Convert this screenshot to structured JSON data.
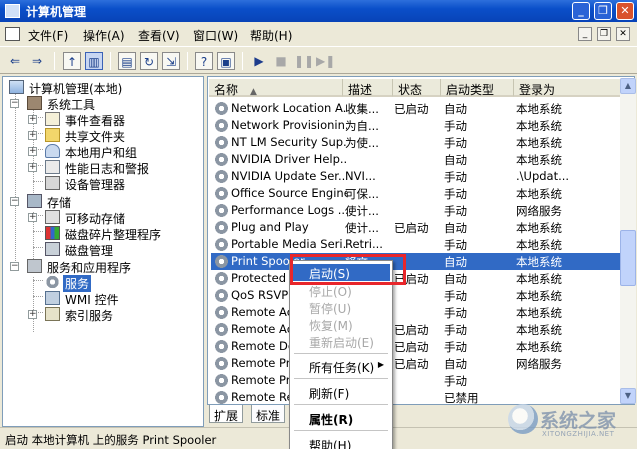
{
  "window": {
    "title": "计算机管理",
    "controls": {
      "minimize": "_",
      "restore": "❐",
      "close": "✕"
    }
  },
  "menubar": {
    "items": [
      "文件(F)",
      "操作(A)",
      "查看(V)",
      "窗口(W)",
      "帮助(H)"
    ],
    "mdi_controls": {
      "minimize": "_",
      "restore": "❐",
      "close": "✕"
    }
  },
  "toolbar": {
    "icons": [
      "back-icon",
      "forward-icon",
      "up-folder-icon",
      "show-tree-icon",
      "properties-icon",
      "refresh-icon",
      "export-icon",
      "help-icon",
      "show-panel-icon",
      "start-icon",
      "stop-icon",
      "pause-icon",
      "restart-icon"
    ]
  },
  "tree": {
    "root": "计算机管理(本地)",
    "nodes": [
      {
        "label": "系统工具",
        "icon": "tools-icon",
        "expander": "−"
      },
      {
        "label": "事件查看器",
        "icon": "event-viewer-icon",
        "expander": "+"
      },
      {
        "label": "共享文件夹",
        "icon": "folder-icon",
        "expander": "+"
      },
      {
        "label": "本地用户和组",
        "icon": "users-icon",
        "expander": "+"
      },
      {
        "label": "性能日志和警报",
        "icon": "performance-icon",
        "expander": "+"
      },
      {
        "label": "设备管理器",
        "icon": "device-manager-icon",
        "expander": ""
      },
      {
        "label": "存储",
        "icon": "storage-icon",
        "expander": "−"
      },
      {
        "label": "可移动存储",
        "icon": "removable-storage-icon",
        "expander": "+"
      },
      {
        "label": "磁盘碎片整理程序",
        "icon": "defrag-icon",
        "expander": ""
      },
      {
        "label": "磁盘管理",
        "icon": "disk-management-icon",
        "expander": ""
      },
      {
        "label": "服务和应用程序",
        "icon": "services-apps-icon",
        "expander": "−"
      },
      {
        "label": "服务",
        "icon": "services-icon",
        "expander": ""
      },
      {
        "label": "WMI 控件",
        "icon": "wmi-icon",
        "expander": ""
      },
      {
        "label": "索引服务",
        "icon": "index-icon",
        "expander": "+"
      }
    ]
  },
  "list": {
    "columns": {
      "name": "名称",
      "name_sort": "▲",
      "desc": "描述",
      "status": "状态",
      "startup": "启动类型",
      "logon": "登录为"
    },
    "rows": [
      {
        "name": "Network Location A...",
        "desc": "收集...",
        "status": "已启动",
        "startup": "自动",
        "logon": "本地系统"
      },
      {
        "name": "Network Provisionin...",
        "desc": "为自...",
        "status": "",
        "startup": "手动",
        "logon": "本地系统"
      },
      {
        "name": "NT LM Security Sup...",
        "desc": "为使...",
        "status": "",
        "startup": "手动",
        "logon": "本地系统"
      },
      {
        "name": "NVIDIA Driver Help...",
        "desc": "",
        "status": "",
        "startup": "自动",
        "logon": "本地系统"
      },
      {
        "name": "NVIDIA Update Ser...",
        "desc": "NVI...",
        "status": "",
        "startup": "手动",
        "logon": ".\\Updat..."
      },
      {
        "name": "Office Source Engine",
        "desc": "可保...",
        "status": "",
        "startup": "手动",
        "logon": "本地系统"
      },
      {
        "name": "Performance Logs ...",
        "desc": "使计...",
        "status": "",
        "startup": "手动",
        "logon": "网络服务"
      },
      {
        "name": "Plug and Play",
        "desc": "使计...",
        "status": "已启动",
        "startup": "自动",
        "logon": "本地系统"
      },
      {
        "name": "Portable Media Seri...",
        "desc": "Retri...",
        "status": "",
        "startup": "手动",
        "logon": "本地系统"
      },
      {
        "name": "Print Spooler",
        "desc": "将文...",
        "status": "",
        "startup": "自动",
        "logon": "本地系统"
      },
      {
        "name": "Protected St",
        "desc": "",
        "status": "已启动",
        "startup": "自动",
        "logon": "本地系统"
      },
      {
        "name": "QoS RSVP",
        "desc": "",
        "status": "",
        "startup": "手动",
        "logon": "本地系统"
      },
      {
        "name": "Remote Acc",
        "desc": "",
        "status": "",
        "startup": "手动",
        "logon": "本地系统"
      },
      {
        "name": "Remote Acc",
        "desc": "",
        "status": "已启动",
        "startup": "手动",
        "logon": "本地系统"
      },
      {
        "name": "Remote Des",
        "desc": "",
        "status": "已启动",
        "startup": "手动",
        "logon": "本地系统"
      },
      {
        "name": "Remote Pro",
        "desc": "",
        "status": "已启动",
        "startup": "自动",
        "logon": "网络服务"
      },
      {
        "name": "Remote Pro",
        "desc": "",
        "status": "",
        "startup": "手动",
        "logon": ""
      },
      {
        "name": "Remote Reg",
        "desc": "",
        "status": "",
        "startup": "已禁用",
        "logon": ""
      }
    ],
    "selected_index": 9
  },
  "scrollbar": {
    "up": "▲",
    "down": "▼"
  },
  "tabs": [
    "扩展",
    "标准"
  ],
  "context_menu": {
    "items": [
      {
        "label": "启动(S)",
        "state": "highlighted"
      },
      {
        "label": "停止(O)",
        "state": "disabled"
      },
      {
        "label": "暂停(U)",
        "state": "disabled"
      },
      {
        "label": "恢复(M)",
        "state": "disabled"
      },
      {
        "label": "重新启动(E)",
        "state": "disabled"
      },
      {
        "label": "所有任务(K)",
        "state": "submenu",
        "arrow": "▶"
      },
      {
        "label": "刷新(F)",
        "state": "normal"
      },
      {
        "label": "属性(R)",
        "state": "bold"
      },
      {
        "label": "帮助(H)",
        "state": "normal"
      }
    ]
  },
  "statusbar": {
    "text": "启动 本地计算机 上的服务 Print Spooler"
  },
  "watermark": {
    "text": "系统之家",
    "sub": "XITONGZHIJIA.NET"
  }
}
